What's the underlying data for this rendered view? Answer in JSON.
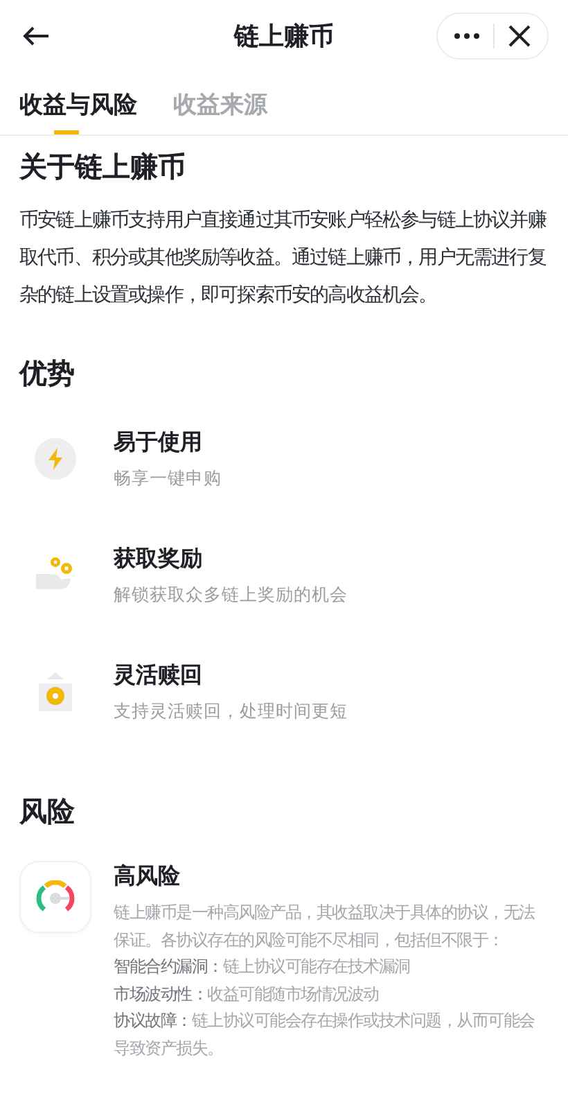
{
  "header": {
    "title": "链上赚币"
  },
  "tabs": [
    {
      "label": "收益与风险",
      "selected": true
    },
    {
      "label": "收益来源",
      "selected": false
    }
  ],
  "about": {
    "title": "关于链上赚币",
    "text": "币安链上赚币支持用户直接通过其币安账户轻松参与链上协议并赚取代币、积分或其他奖励等收益。通过链上赚币，用户无需进行复杂的链上设置或操作，即可探索币安的高收益机会。"
  },
  "advantages": {
    "title": "优势",
    "items": [
      {
        "kind": "lightning",
        "title": "易于使用",
        "text": "畅享一键申购"
      },
      {
        "kind": "coins",
        "title": "获取奖励",
        "text": "解锁获取众多链上奖励的机会"
      },
      {
        "kind": "redeem",
        "title": "灵活赎回",
        "text": "支持灵活赎回，处理时间更短"
      }
    ]
  },
  "risks": {
    "title": "风险",
    "items": [
      {
        "kind": "gauge",
        "title": "高风险",
        "text": "链上赚币是一种高风险产品，其收益取决于具体的协议，无法保证。各协议存在的风险可能不尽相同，包括但不限于：",
        "points": [
          {
            "label": "智能合约漏洞：",
            "text": "链上协议可能存在技术漏洞"
          },
          {
            "label": "市场波动性：",
            "text": "收益可能随市场情况波动"
          },
          {
            "label": "协议故障：",
            "text": "链上协议可能会存在操作或技术问题，从而可能会导致资产损失。"
          }
        ]
      }
    ]
  }
}
